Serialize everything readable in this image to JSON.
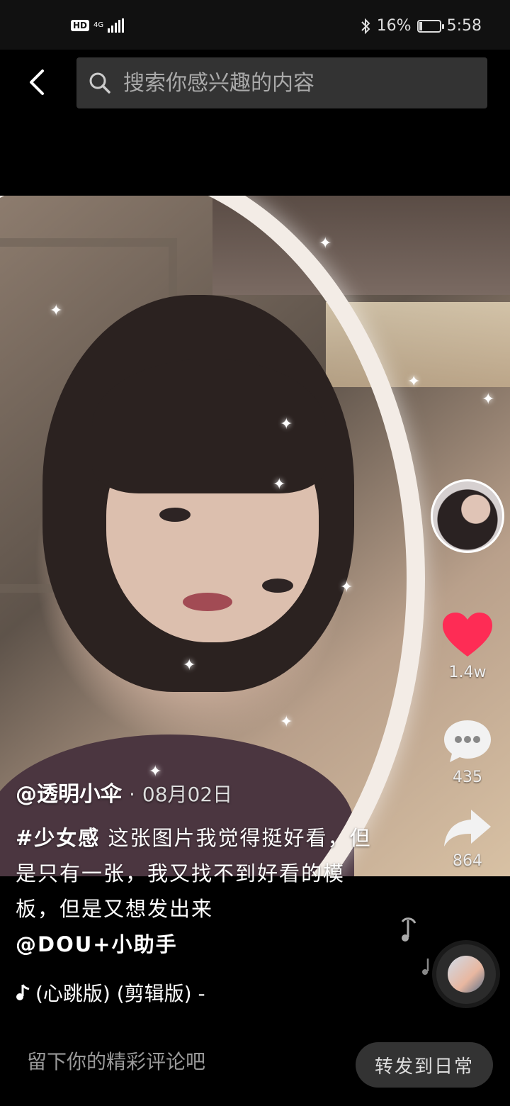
{
  "status_bar": {
    "hd": "HD",
    "network": "4G",
    "battery_percent": "16%",
    "battery_level": 0.16,
    "time": "5:58"
  },
  "search": {
    "placeholder": "搜索你感兴趣的内容",
    "back_icon": "chevron-left-icon",
    "search_icon": "search-icon"
  },
  "actions": {
    "likes": "1.4w",
    "comments": "435",
    "shares": "864",
    "like_color": "#fe2c55"
  },
  "post": {
    "author": "@透明小伞",
    "separator": "·",
    "date": "08月02日",
    "hashtag": "#少女感",
    "text": " 这张图片我觉得挺好看，但是只有一张，我又找不到好看的模板，但是又想发出来",
    "mention": "@DOU+小助手"
  },
  "music": {
    "title": "(心跳版) (剪辑版) -"
  },
  "bottom": {
    "comment_placeholder": "留下你的精彩评论吧",
    "repost_label": "转发到日常"
  }
}
